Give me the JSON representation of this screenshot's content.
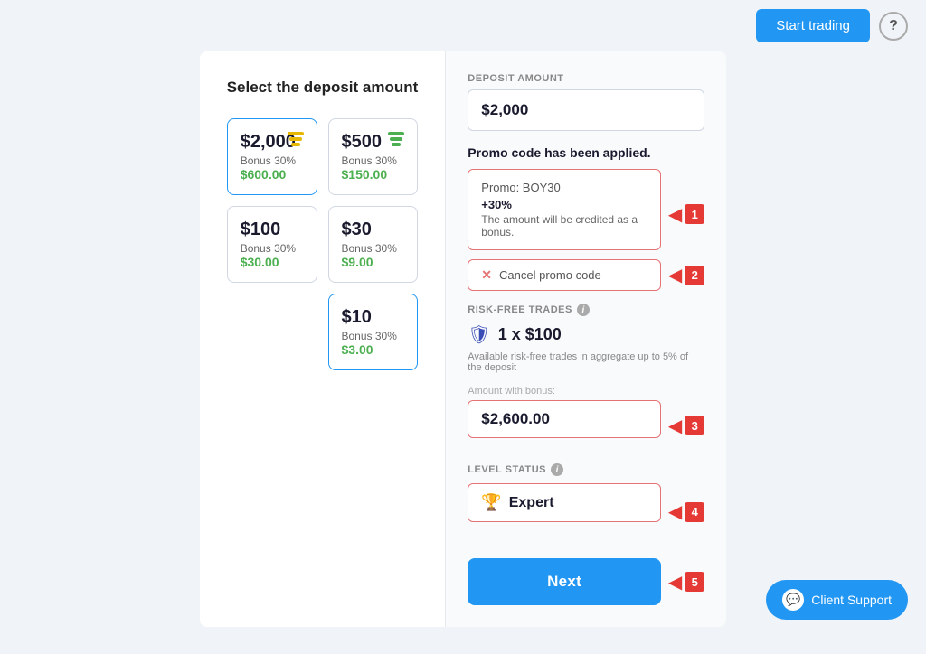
{
  "topbar": {
    "start_trading_label": "Start trading",
    "help_icon": "?"
  },
  "left_panel": {
    "title": "Select the deposit amount",
    "cards": [
      {
        "amount": "$2,000",
        "bonus_label": "Bonus 30%",
        "bonus_value": "$600.00",
        "selected": true,
        "icon_type": "stack-gold"
      },
      {
        "amount": "$500",
        "bonus_label": "Bonus 30%",
        "bonus_value": "$150.00",
        "selected": false,
        "icon_type": "stack-green"
      },
      {
        "amount": "$100",
        "bonus_label": "Bonus 30%",
        "bonus_value": "$30.00",
        "selected": false,
        "icon_type": "none"
      },
      {
        "amount": "$30",
        "bonus_label": "Bonus 30%",
        "bonus_value": "$9.00",
        "selected": false,
        "icon_type": "none"
      },
      {
        "amount": "$10",
        "bonus_label": "Bonus 30%",
        "bonus_value": "$3.00",
        "selected": true,
        "icon_type": "none"
      }
    ]
  },
  "right_panel": {
    "deposit_amount_label": "DEPOSIT AMOUNT",
    "deposit_amount_value": "$2,000",
    "promo_applied_label": "Promo code has been applied.",
    "promo_code_name": "Promo: BOY30",
    "promo_percent": "+30%",
    "promo_description": "The amount will be credited as a bonus.",
    "cancel_promo_label": "Cancel promo code",
    "risk_free_label": "RISK-FREE TRADES",
    "risk_free_value": "1 x $100",
    "risk_free_note": "Available risk-free trades in aggregate up to 5% of the deposit",
    "amount_with_bonus_label": "Amount with bonus:",
    "amount_with_bonus_value": "$2,600.00",
    "level_status_label": "LEVEL STATUS",
    "level_status_value": "Expert",
    "next_button_label": "Next"
  },
  "annotations": {
    "1": "1",
    "2": "2",
    "3": "3",
    "4": "4",
    "5": "5"
  },
  "client_support": {
    "label": "Client Support"
  }
}
